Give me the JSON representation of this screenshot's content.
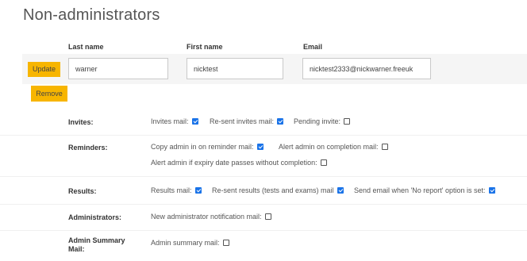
{
  "page_title": "Non-administrators",
  "columns": {
    "last_name": "Last name",
    "first_name": "First name",
    "email": "Email"
  },
  "row": {
    "update_label": "Update",
    "remove_label": "Remove",
    "last_name": "warner",
    "first_name": "nicktest",
    "email": "nicktest2333@nickwarner.freeuk"
  },
  "sections": {
    "invites": {
      "title": "Invites:",
      "options": [
        {
          "label": "Invites mail:",
          "checked": true
        },
        {
          "label": "Re-sent invites mail:",
          "checked": true
        },
        {
          "label": "Pending invite:",
          "checked": false
        }
      ]
    },
    "reminders": {
      "title": "Reminders:",
      "options": [
        {
          "label": "Copy admin in on reminder mail:",
          "checked": true
        },
        {
          "label": "Alert admin on completion mail:",
          "checked": false
        },
        {
          "label": "Alert admin if expiry date passes without completion:",
          "checked": false
        }
      ]
    },
    "results": {
      "title": "Results:",
      "options": [
        {
          "label": "Results mail:",
          "checked": true
        },
        {
          "label": "Re-sent results (tests and exams) mail",
          "checked": true
        },
        {
          "label": "Send email when 'No report' option is set:",
          "checked": true
        }
      ]
    },
    "administrators": {
      "title": "Administrators:",
      "options": [
        {
          "label": "New administrator notification mail:",
          "checked": false
        }
      ]
    },
    "admin_summary": {
      "title_line1": "Admin Summary",
      "title_line2": "Mail:",
      "options": [
        {
          "label": "Admin summary mail:",
          "checked": false
        }
      ]
    }
  }
}
